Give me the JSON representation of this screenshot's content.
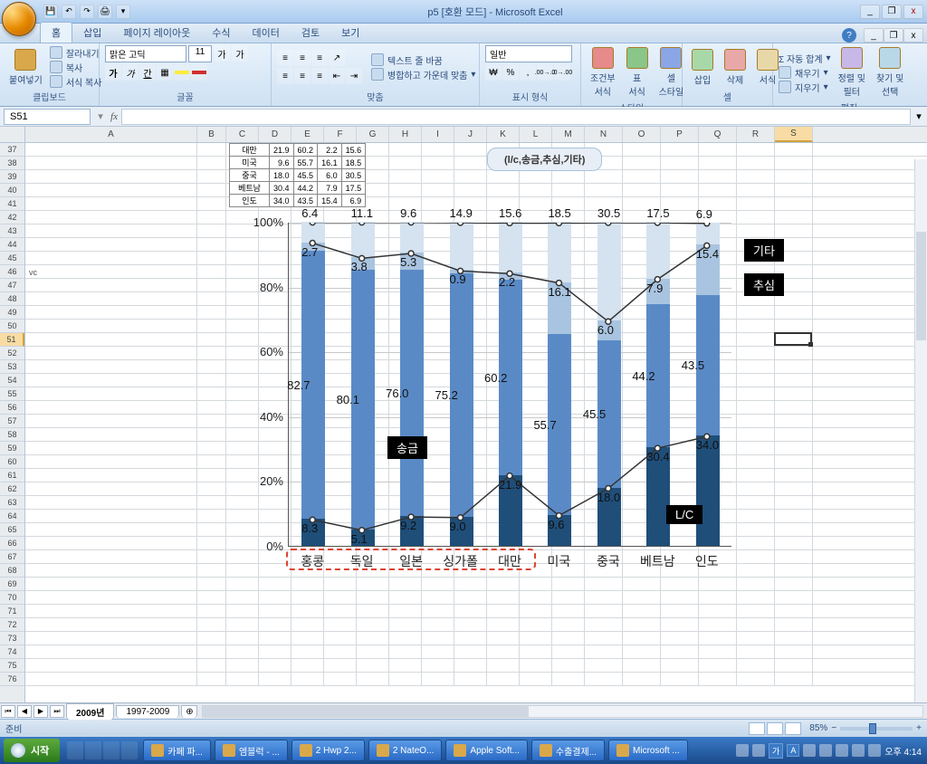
{
  "title": "p5 [호환 모드] - Microsoft Excel",
  "qat": {
    "save": "💾",
    "undo": "↶",
    "redo": "↷",
    "print": "🖨"
  },
  "win": {
    "min": "_",
    "max": "❐",
    "close": "x"
  },
  "tabs": [
    "홈",
    "삽입",
    "페이지 레이아웃",
    "수식",
    "데이터",
    "검토",
    "보기"
  ],
  "ribbon": {
    "clipboard": {
      "paste": "붙여넣기",
      "cut": "잘라내기",
      "copy": "복사",
      "fmt": "서식 복사",
      "title": "클립보드"
    },
    "font": {
      "face": "맑은 고딕",
      "size": "11",
      "title": "글꼴",
      "bold": "가",
      "italic": "가",
      "underline": "간",
      "grow": "가",
      "shrink": "가"
    },
    "align": {
      "wrap": "텍스트 줄 바꿈",
      "merge": "병합하고 가운데 맞춤",
      "title": "맞춤"
    },
    "number": {
      "name": "일반",
      "currency": "₩",
      "percent": "%",
      "comma": ",",
      "inc": ".00→.0",
      "dec": ".0→.00",
      "title": "표시 형식"
    },
    "styles": {
      "cond": "조건부\n서식",
      "table": "표\n서식",
      "cell": "셀\n스타일",
      "title": "스타일"
    },
    "cells": {
      "insert": "삽입",
      "delete": "삭제",
      "format": "서식",
      "title": "셀"
    },
    "editing": {
      "sum": "Σ 자동 합계",
      "fill": "채우기",
      "clear": "지우기",
      "sort": "정렬 및\n필터",
      "find": "찾기 및\n선택",
      "title": "편집"
    }
  },
  "namebox": "S51",
  "colheaders": [
    "A",
    "B",
    "C",
    "D",
    "E",
    "F",
    "G",
    "H",
    "I",
    "J",
    "K",
    "L",
    "M",
    "N",
    "O",
    "P",
    "Q",
    "R",
    "S"
  ],
  "rowstart": 37,
  "rowcount": 40,
  "selectedRow": 51,
  "selectedColIdx": 18,
  "vc_text": "vc",
  "data_table": [
    {
      "label": "대만",
      "c": 21.9,
      "d": 60.2,
      "e": 2.2,
      "f": 15.6
    },
    {
      "label": "미국",
      "c": 9.6,
      "d": 55.7,
      "e": 16.1,
      "f": 18.5
    },
    {
      "label": "중국",
      "c": 18.0,
      "d": 45.5,
      "e": 6.0,
      "f": 30.5
    },
    {
      "label": "베트남",
      "c": 30.4,
      "d": 44.2,
      "e": 7.9,
      "f": 17.5
    },
    {
      "label": "인도",
      "c": 34.0,
      "d": 43.5,
      "e": 15.4,
      "f": 6.9
    }
  ],
  "callout_text": "(l/c,송금,추심,기타)",
  "chart_data": {
    "type": "bar",
    "stacked": true,
    "ylabel": "",
    "xlabel": "",
    "ylim": [
      0,
      100
    ],
    "yticks": [
      "0%",
      "20%",
      "40%",
      "60%",
      "80%",
      "100%"
    ],
    "categories": [
      "홍콩",
      "독일",
      "일본",
      "싱가폴",
      "대만",
      "미국",
      "중국",
      "베트남",
      "인도"
    ],
    "series": [
      {
        "name": "L/C",
        "values": [
          8.3,
          5.1,
          9.2,
          9.0,
          21.9,
          9.6,
          18.0,
          30.4,
          34.0
        ],
        "color": "#1f4e79"
      },
      {
        "name": "송금",
        "values": [
          82.7,
          80.1,
          76.0,
          75.2,
          60.2,
          55.7,
          45.5,
          44.2,
          43.5
        ],
        "color": "#5a8ac6"
      },
      {
        "name": "추심",
        "values": [
          2.7,
          3.8,
          5.3,
          0.9,
          2.2,
          16.1,
          6.0,
          7.9,
          15.4
        ],
        "color": "#a9c4e0"
      },
      {
        "name": "기타",
        "values": [
          6.4,
          11.1,
          9.6,
          14.9,
          15.6,
          18.5,
          30.5,
          17.5,
          6.9
        ],
        "color": "#d5e2ef"
      }
    ],
    "legend_boxes": {
      "송금": "송금",
      "L/C": "L/C",
      "추심": "추심",
      "기타": "기타"
    },
    "dashed_group_range": [
      0,
      4
    ]
  },
  "sheet_tabs": [
    "2009년",
    "1997-2009"
  ],
  "active_sheet": 0,
  "status": {
    "ready": "준비",
    "zoom": "85%"
  },
  "taskbar": {
    "start": "시작",
    "items": [
      "카페 파...",
      "엠블럭 - ...",
      "2 Hwp 2...",
      "2 NateO...",
      "Apple Soft...",
      "수출결제...",
      "Microsoft ..."
    ],
    "lang": "A",
    "time": "오후 4:14"
  }
}
